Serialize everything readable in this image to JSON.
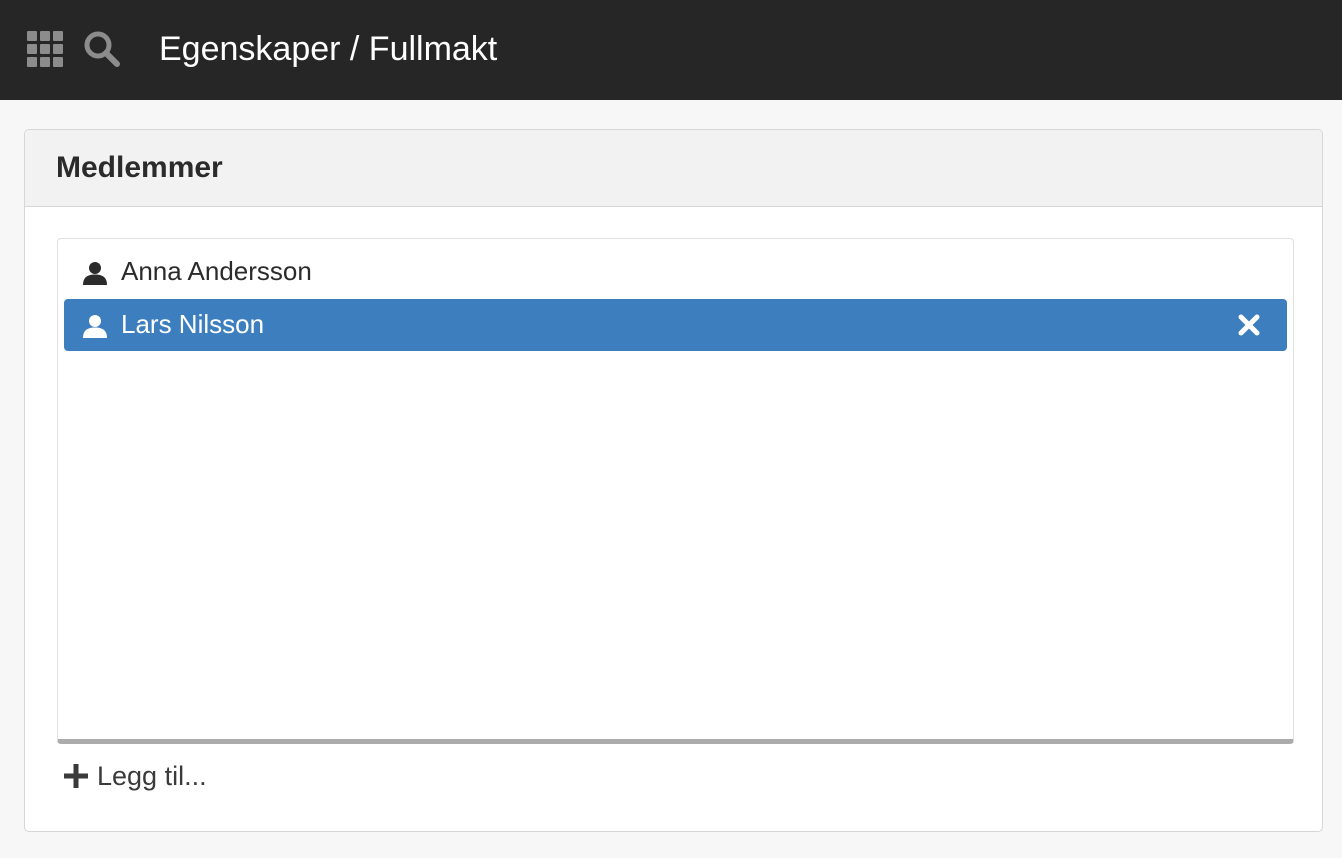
{
  "header": {
    "title": "Egenskaper / Fullmakt",
    "apps_icon": "apps-grid-icon",
    "search_icon": "search-icon",
    "background": "#262626"
  },
  "panel": {
    "title": "Medlemmer",
    "members": [
      {
        "name": "Anna Andersson",
        "icon": "user-icon",
        "selected": false
      },
      {
        "name": "Lars Nilsson",
        "icon": "user-icon",
        "selected": true,
        "action_icon": "close-icon"
      }
    ],
    "add_label": "Legg til...",
    "add_icon": "plus-icon"
  },
  "colors": {
    "accent": "#3d7fbe",
    "text": "#2b2b2b",
    "panel_header": "#f2f2f2"
  }
}
